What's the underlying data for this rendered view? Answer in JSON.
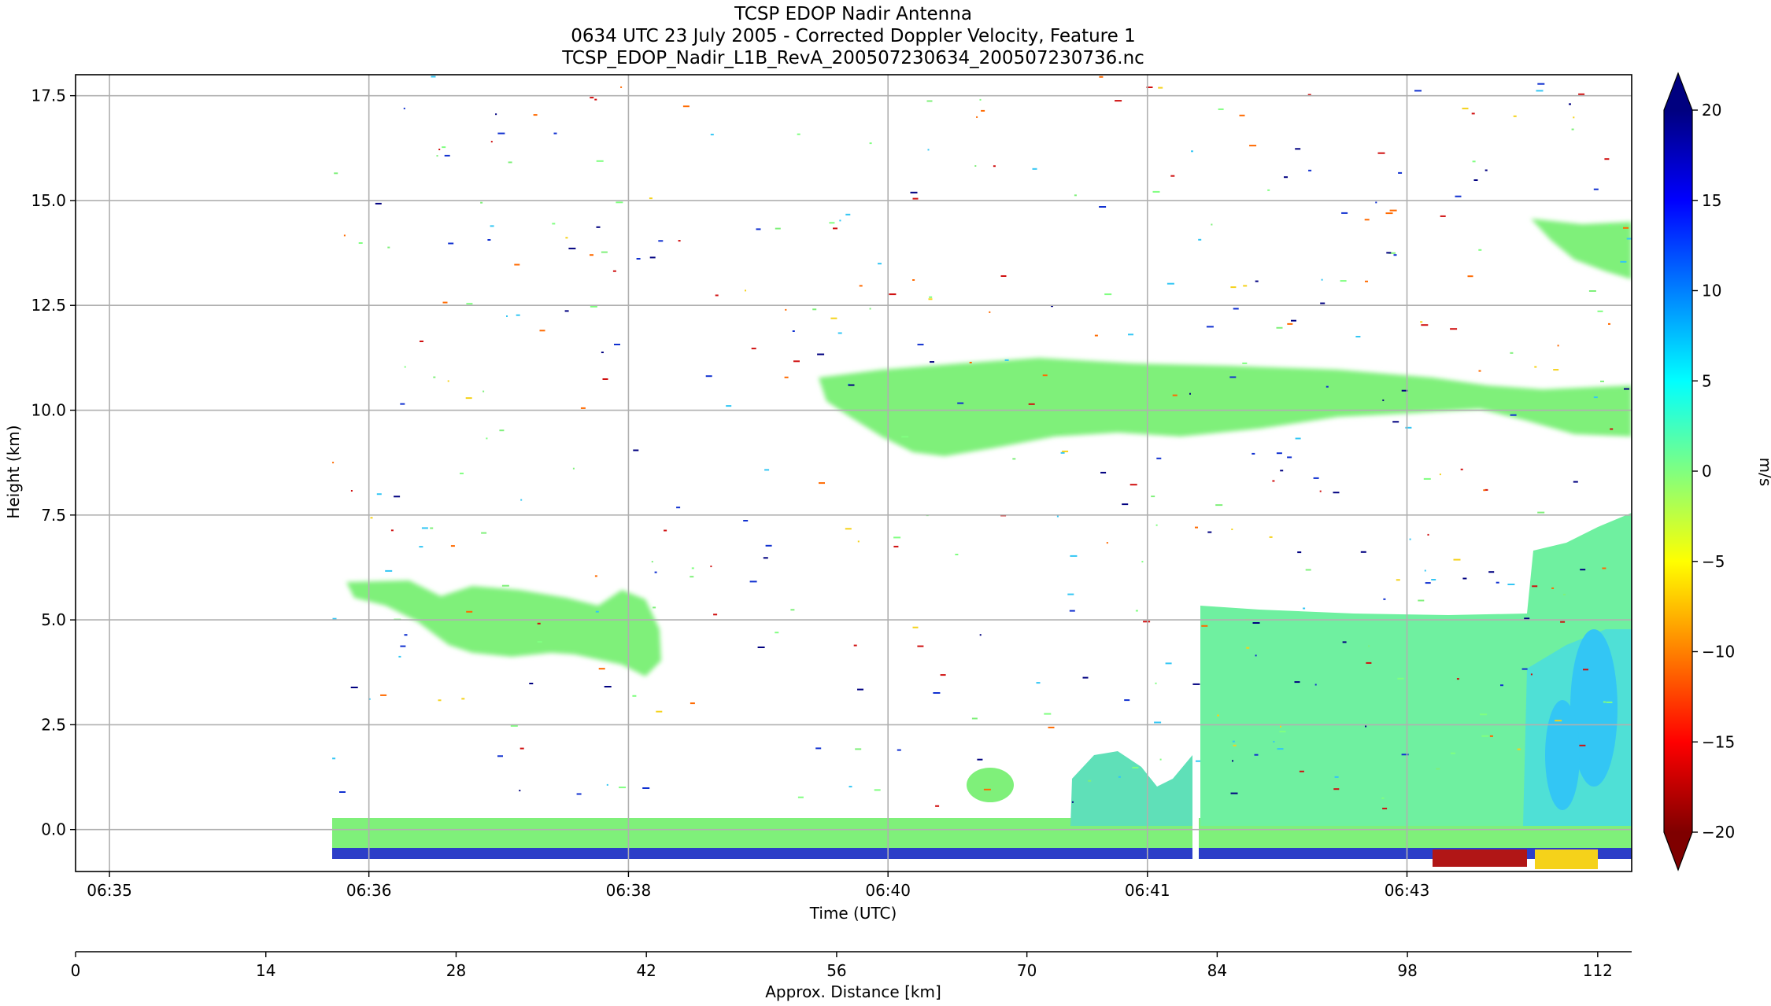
{
  "chart_data": {
    "type": "heatmap",
    "title": "TCSP EDOP Nadir Antenna",
    "subtitle": "0634 UTC 23 July 2005 - Corrected Doppler Velocity, Feature 1",
    "filename": "TCSP_EDOP_Nadir_L1B_RevA_200507230634_200507230736.nc",
    "xlabel": "Time (UTC)",
    "ylabel": "Height (km)",
    "x_tick_labels": [
      "06:35",
      "06:36",
      "06:38",
      "06:40",
      "06:41",
      "06:43"
    ],
    "y_ticks": [
      0.0,
      2.5,
      5.0,
      7.5,
      10.0,
      12.5,
      15.0,
      17.5
    ],
    "y_tick_labels": [
      "0.0",
      "2.5",
      "5.0",
      "7.5",
      "10.0",
      "12.5",
      "15.0",
      "17.5"
    ],
    "ylim": [
      -1.0,
      18.0
    ],
    "grid": true,
    "secondary_axis": {
      "label": "Approx. Distance [km]",
      "ticks": [
        0,
        14,
        28,
        42,
        56,
        70,
        84,
        98,
        112
      ],
      "xlim": [
        0,
        114.5
      ]
    },
    "colorbar": {
      "label": "m/s",
      "range": [
        -20,
        20
      ],
      "ticks": [
        20,
        15,
        10,
        5,
        0,
        -5,
        -10,
        -15,
        -20
      ],
      "tick_labels": [
        "20",
        "15",
        "10",
        "5",
        "0",
        "−5",
        "−10",
        "−15",
        "−20"
      ],
      "extend": "both",
      "colormap": "jet_r",
      "colors": [
        "#7f0000",
        "#ff0000",
        "#ff8000",
        "#ffff00",
        "#80ff80",
        "#00ffff",
        "#0080ff",
        "#0000ff",
        "#00007f"
      ]
    }
  }
}
